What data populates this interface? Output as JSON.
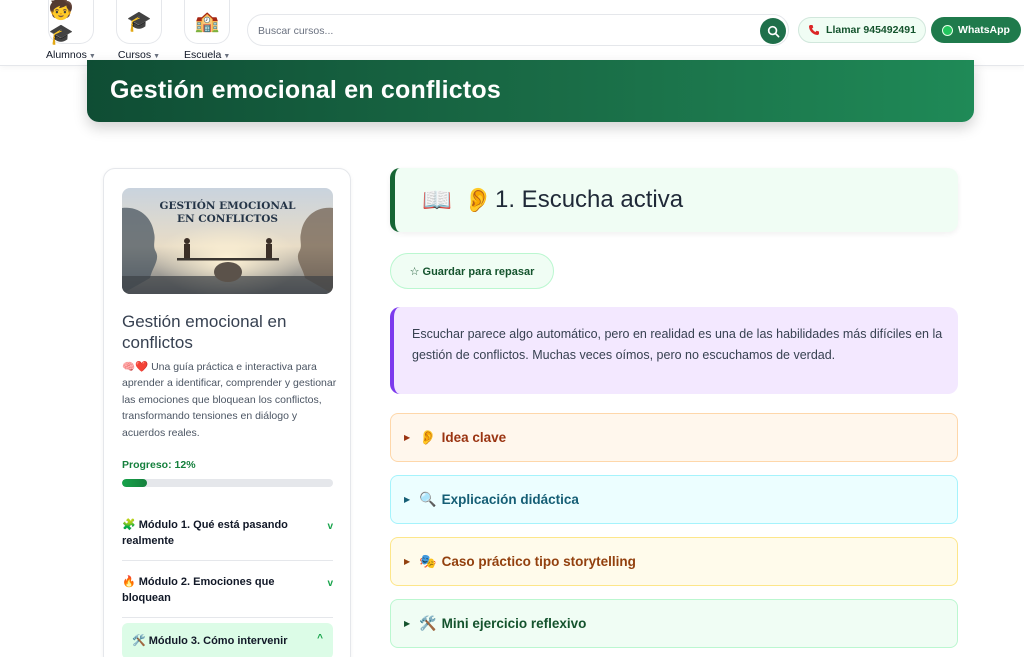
{
  "header": {
    "nav": [
      {
        "label": "Alumnos",
        "icon": "student-graduation-cap-icon"
      },
      {
        "label": "Cursos",
        "icon": "graduation-cap-icon"
      },
      {
        "label": "Escuela",
        "icon": "school-building-icon"
      }
    ],
    "search_placeholder": "Buscar cursos...",
    "call_label": "Llamar 945492491",
    "whatsapp_label": "WhatsApp"
  },
  "banner": {
    "title": "Gestión emocional en conflictos"
  },
  "sidebar": {
    "cover": {
      "title_line1": "GESTIÓN EMOCIONAL",
      "title_line2": "EN CONFLICTOS"
    },
    "course_title": "Gestión emocional en conflictos",
    "description": "🧠❤️ Una guía práctica e interactiva para aprender a identificar, comprender y gestionar las emociones que bloquean los conflictos, transformando tensiones en diálogo y acuerdos reales.",
    "progress_label": "Progreso: 12%",
    "progress_value": 0.12,
    "modules": [
      {
        "label": "🧩 Módulo 1. Qué está pasando realmente",
        "chevron": "v"
      },
      {
        "label": "🔥 Módulo 2. Emociones que bloquean",
        "chevron": "v"
      },
      {
        "label": "🛠️ Módulo 3. Cómo intervenir",
        "chevron": "^"
      }
    ]
  },
  "lesson": {
    "icon1": "📖",
    "icon2": "👂",
    "title": "1. Escucha activa",
    "save_label": "☆ Guardar para repasar",
    "intro": "Escuchar parece algo automático, pero en realidad es una de las habilidades más difíciles en la gestión de conflictos. Muchas veces oímos, pero no escuchamos de verdad.",
    "sections": [
      {
        "emoji": "👂",
        "label": "Idea clave"
      },
      {
        "emoji": "🔍",
        "label": "Explicación didáctica"
      },
      {
        "emoji": "🎭",
        "label": "Caso práctico tipo storytelling"
      },
      {
        "emoji": "🛠️",
        "label": "Mini ejercicio reflexivo"
      }
    ]
  },
  "colors": {
    "brand_green": "#1a6d47",
    "accent_purple": "#7c3aed",
    "progress_green": "#16a34a"
  }
}
